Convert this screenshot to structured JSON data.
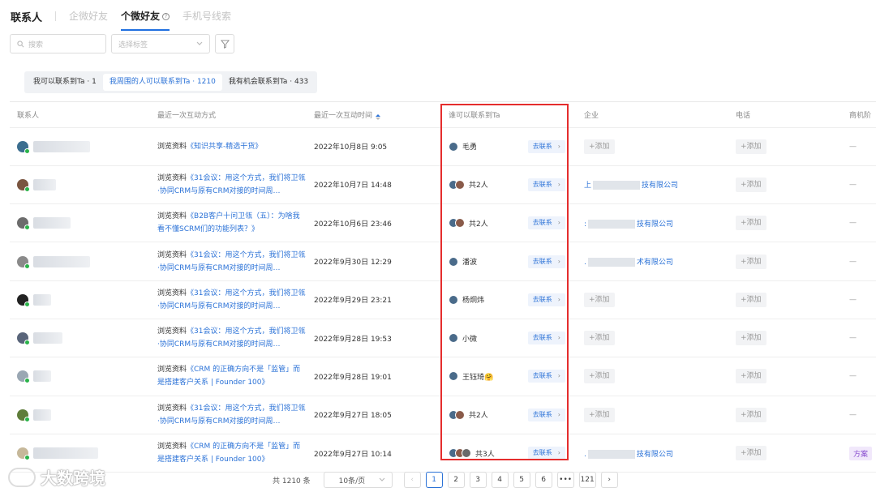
{
  "header": {
    "title": "联系人",
    "tabs": [
      {
        "label": "企微好友"
      },
      {
        "label": "个微好友"
      },
      {
        "label": "手机号线索"
      }
    ]
  },
  "filters": {
    "search_placeholder": "搜索",
    "tag_placeholder": "选择标签"
  },
  "segments": [
    {
      "label": "我可以联系到Ta · 1"
    },
    {
      "label": "我周围的人可以联系到Ta · 1210"
    },
    {
      "label": "我有机会联系到Ta · 433"
    }
  ],
  "columns": [
    "联系人",
    "最近一次互动方式",
    "最近一次互动时间",
    "谁可以联系到Ta",
    "企业",
    "电话",
    "商机阶"
  ],
  "rows": [
    {
      "interaction": "浏览资料《知识共享-精选干货》",
      "time": "2022年10月8日 9:05",
      "who": "毛勇",
      "company": "",
      "phone": "+添加",
      "stage": "—"
    },
    {
      "interaction": "浏览资料《31会议：用这个方式，我们将卫瓴·协同CRM与原有CRM对接的时间周…",
      "time": "2022年10月7日 14:48",
      "who": "共2人",
      "company": "上 技有限公司",
      "phone": "+添加",
      "stage": "—"
    },
    {
      "interaction": "浏览资料《B2B客户十问卫瓴（五）：为啥我看不懂SCRM们的功能列表？》",
      "time": "2022年10月6日 23:46",
      "who": "共2人",
      "company": ": 技有限公司",
      "phone": "+添加",
      "stage": "—"
    },
    {
      "interaction": "浏览资料《31会议：用这个方式，我们将卫瓴·协同CRM与原有CRM对接的时间周…",
      "time": "2022年9月30日 12:29",
      "who": "潘波",
      "company": ". 术有限公司",
      "phone": "+添加",
      "stage": "—"
    },
    {
      "interaction": "浏览资料《31会议：用这个方式，我们将卫瓴·协同CRM与原有CRM对接的时间周…",
      "time": "2022年9月29日 23:21",
      "who": "杨炯炜",
      "company": "",
      "phone": "+添加",
      "stage": "—"
    },
    {
      "interaction": "浏览资料《31会议：用这个方式，我们将卫瓴·协同CRM与原有CRM对接的时间周…",
      "time": "2022年9月28日 19:53",
      "who": "小微",
      "company": "",
      "phone": "+添加",
      "stage": "—"
    },
    {
      "interaction": "浏览资料《CRM 的正确方向不是「监管」而是搭建客户关系 | Founder 100》",
      "time": "2022年9月28日 19:01",
      "who": "王钰琦🤗",
      "company": "",
      "phone": "+添加",
      "stage": "—"
    },
    {
      "interaction": "浏览资料《31会议：用这个方式，我们将卫瓴·协同CRM与原有CRM对接的时间周…",
      "time": "2022年9月27日 18:05",
      "who": "共2人",
      "company": "",
      "phone": "+添加",
      "stage": "—"
    },
    {
      "interaction": "浏览资料《CRM 的正确方向不是「监管」而是搭建客户关系 | Founder 100》",
      "time": "2022年9月27日 10:14",
      "who": "共3人",
      "company": ". 技有限公司",
      "phone": "+添加",
      "stage": "方案"
    }
  ],
  "row_action": "去联系",
  "company_add": "+添加",
  "pager": {
    "total": "共 1210 条",
    "size": "10条/页",
    "pages": [
      "1",
      "2",
      "3",
      "4",
      "5",
      "6",
      "•••",
      "121"
    ]
  },
  "watermark": "大数跨境"
}
